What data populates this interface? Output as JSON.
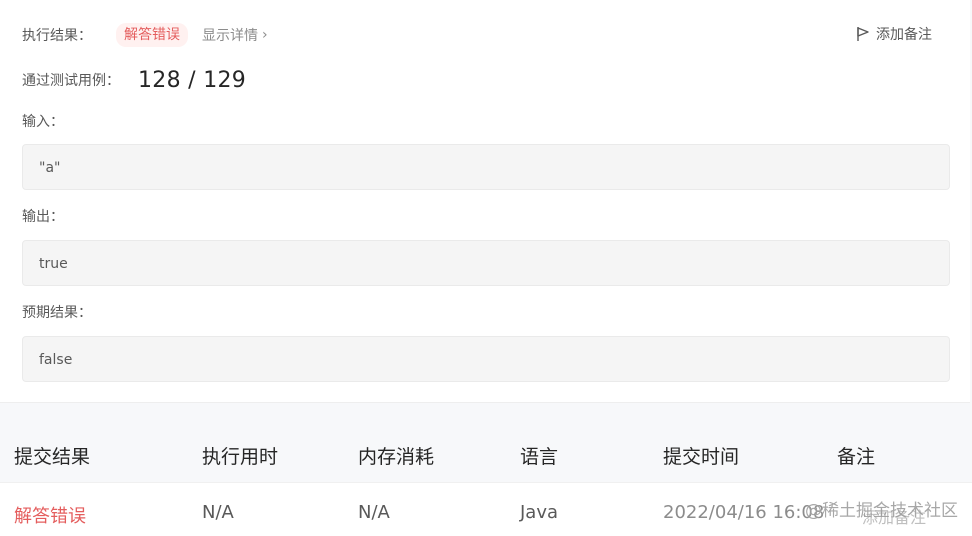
{
  "result": {
    "label": "执行结果：",
    "status": "解答错误",
    "details_link": "显示详情",
    "details_chevron": "›",
    "add_note": "添加备注",
    "passed_label": "通过测试用例：",
    "passed_value": "128 / 129"
  },
  "io": {
    "input_label": "输入：",
    "input_value": "\"a\"",
    "output_label": "输出：",
    "output_value": "true",
    "expected_label": "预期结果：",
    "expected_value": "false"
  },
  "table": {
    "headers": [
      "提交结果",
      "执行用时",
      "内存消耗",
      "语言",
      "提交时间",
      "备注"
    ],
    "rows": [
      {
        "status": "解答错误",
        "runtime": "N/A",
        "memory": "N/A",
        "language": "Java",
        "time": "2022/04/16 16:08",
        "note": "添加备注"
      }
    ]
  },
  "watermark": "@稀土掘金技术社区",
  "colors": {
    "error": "#e45d5d",
    "badge_bg": "#fff1f0",
    "box_bg": "#f5f5f5",
    "page_bg": "#f7f8fa"
  },
  "icons": {
    "note": "flag-icon",
    "details": "chevron-right-icon"
  }
}
